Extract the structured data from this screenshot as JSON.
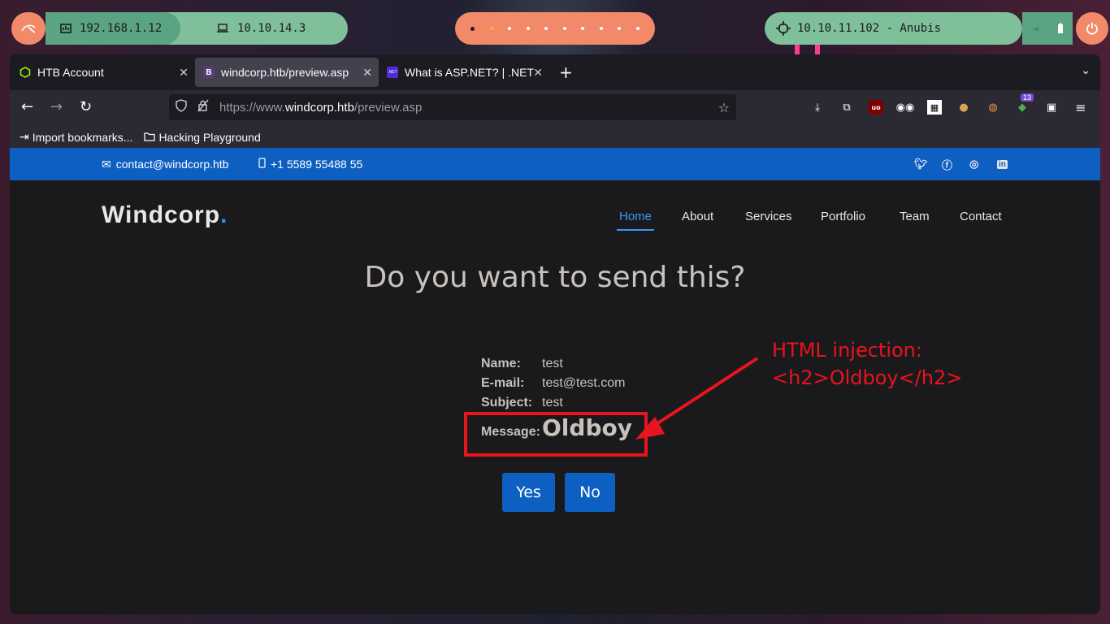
{
  "system_bar": {
    "local_ip": "192.168.1.12",
    "vpn_ip": "10.10.14.3",
    "target": "10.10.11.102 - Anubis"
  },
  "browser": {
    "tabs": [
      {
        "title": "HTB Account",
        "icon": "hexagon-icon",
        "active": false
      },
      {
        "title": "windcorp.htb/preview.asp",
        "icon": "bootstrap-icon",
        "active": true
      },
      {
        "title": "What is ASP.NET? | .NET",
        "icon": "dotnet-icon",
        "active": false
      }
    ],
    "url_prefix": "https://www.",
    "url_domain": "windcorp.htb",
    "url_path": "/preview.asp",
    "extension_badge": "13",
    "bookmarks": [
      {
        "label": "Import bookmarks...",
        "icon": "import-icon"
      },
      {
        "label": "Hacking Playground",
        "icon": "folder-icon"
      }
    ]
  },
  "site": {
    "email": "contact@windcorp.htb",
    "phone": "+1 5589 55488 55",
    "logo_text": "Windcorp",
    "logo_dot": ".",
    "nav": [
      "Home",
      "About",
      "Services",
      "Portfolio",
      "Team",
      "Contact"
    ],
    "active_nav": "Home",
    "heading": "Do you want to send this?",
    "fields": {
      "name_label": "Name:",
      "name_value": "test",
      "email_label": "E-mail:",
      "email_value": "test@test.com",
      "subject_label": "Subject:",
      "subject_value": "test",
      "message_label": "Message:",
      "message_value": "Oldboy"
    },
    "yes_label": "Yes",
    "no_label": "No"
  },
  "annotation": {
    "line1": "HTML injection:",
    "line2": "<h2>Oldboy</h2>",
    "color": "#e8141e"
  },
  "colors": {
    "brand_blue": "#0d5fc2",
    "accent_blue": "#3b95f5",
    "pill_green": "#7fbf9a",
    "pill_orange": "#f28a6a"
  }
}
